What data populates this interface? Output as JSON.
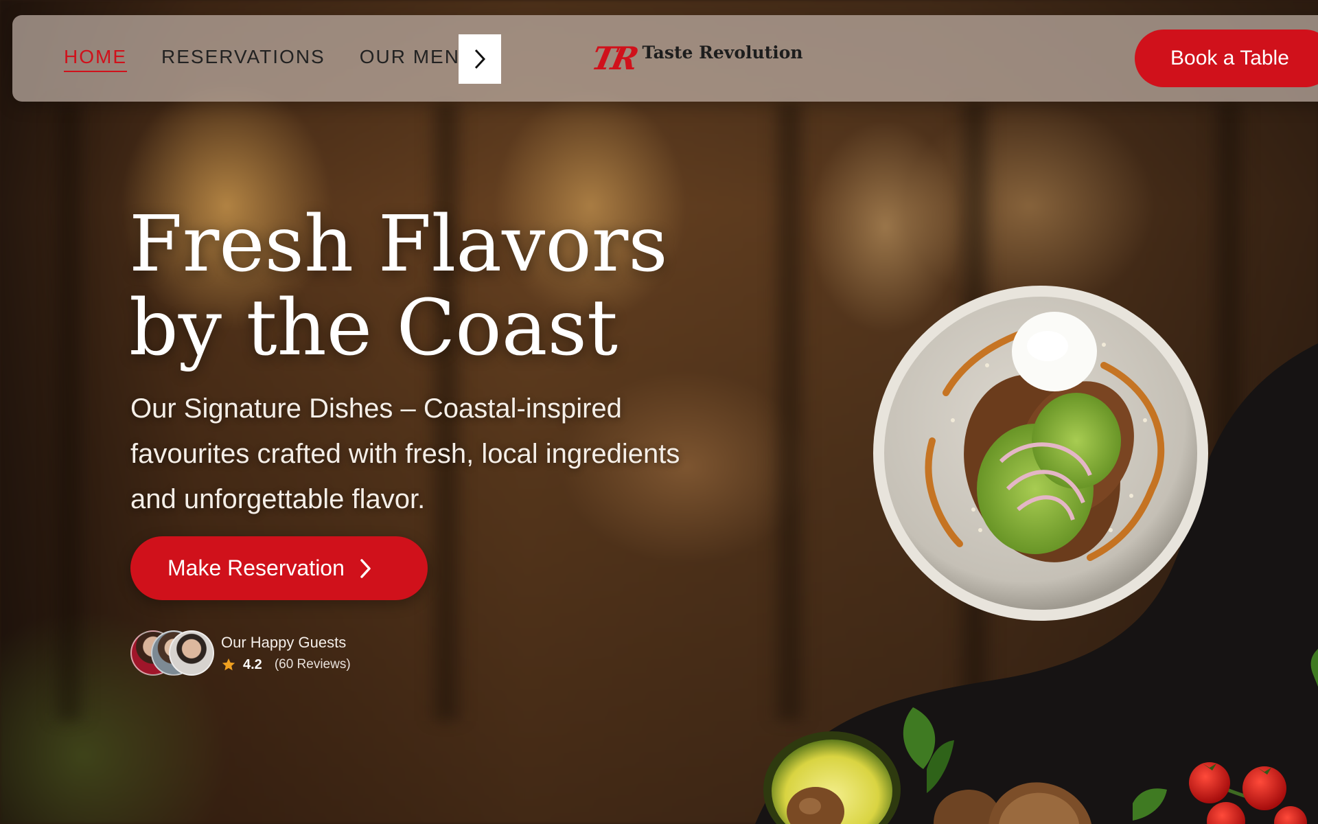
{
  "nav": {
    "links": [
      {
        "label": "HOME",
        "active": true
      },
      {
        "label": "RESERVATIONS",
        "active": false
      },
      {
        "label": "OUR MENU",
        "active": false
      }
    ],
    "next_icon": "chevron-right-icon"
  },
  "brand": {
    "mark": "TR",
    "name": "Taste Revolution"
  },
  "cta": {
    "book_label": "Book a Table",
    "reserve_label": "Make Reservation"
  },
  "hero": {
    "title_line1": "Fresh Flavors",
    "title_line2": "by the Coast",
    "subtitle": "Our Signature Dishes – Coastal-inspired favourites crafted with fresh, local ingredients and unforgettable flavor."
  },
  "guests": {
    "label": "Our Happy Guests",
    "rating": "4.2",
    "reviews": "(60 Reviews)",
    "star_icon": "star-icon"
  },
  "colors": {
    "accent": "#d0111b",
    "navbar": "rgba(190,175,165,0.72)",
    "text_light": "#ffffff"
  }
}
